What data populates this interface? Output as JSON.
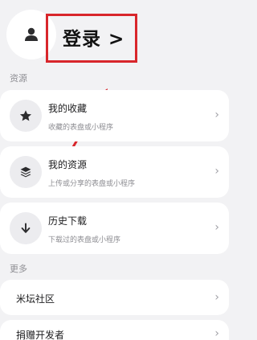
{
  "header": {
    "login_label": "登录 >"
  },
  "sections": {
    "resources_label": "资源",
    "more_label": "更多"
  },
  "resource_items": [
    {
      "title": "我的收藏",
      "subtitle": "收藏的表盘或小程序",
      "icon": "star-icon"
    },
    {
      "title": "我的资源",
      "subtitle": "上传或分享的表盘或小程序",
      "icon": "layers-icon"
    },
    {
      "title": "历史下载",
      "subtitle": "下载过的表盘或小程序",
      "icon": "download-arrow-icon"
    }
  ],
  "more_items": [
    {
      "title": "米坛社区"
    },
    {
      "title": "捐赠开发者"
    }
  ],
  "chevron_glyph": "›",
  "colors": {
    "annotation_red": "#d8262b",
    "background": "#f2f2f4"
  }
}
